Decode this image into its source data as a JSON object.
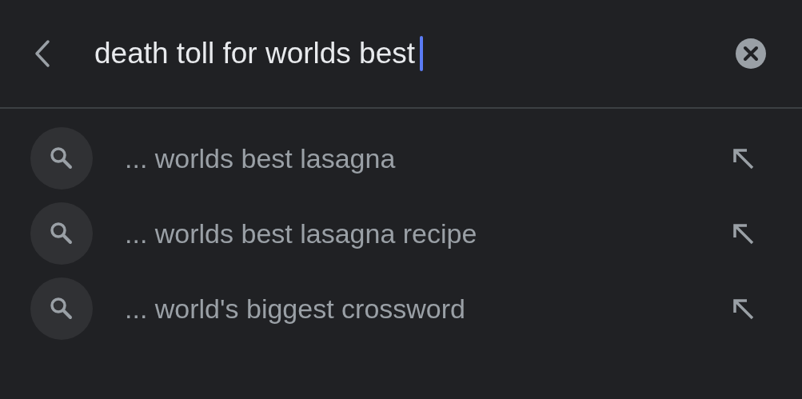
{
  "search": {
    "value": "death toll for worlds best",
    "focused": true
  },
  "suggestions": [
    {
      "text": "... worlds best lasagna"
    },
    {
      "text": "... worlds best lasagna recipe"
    },
    {
      "text": "... world's biggest crossword"
    }
  ]
}
